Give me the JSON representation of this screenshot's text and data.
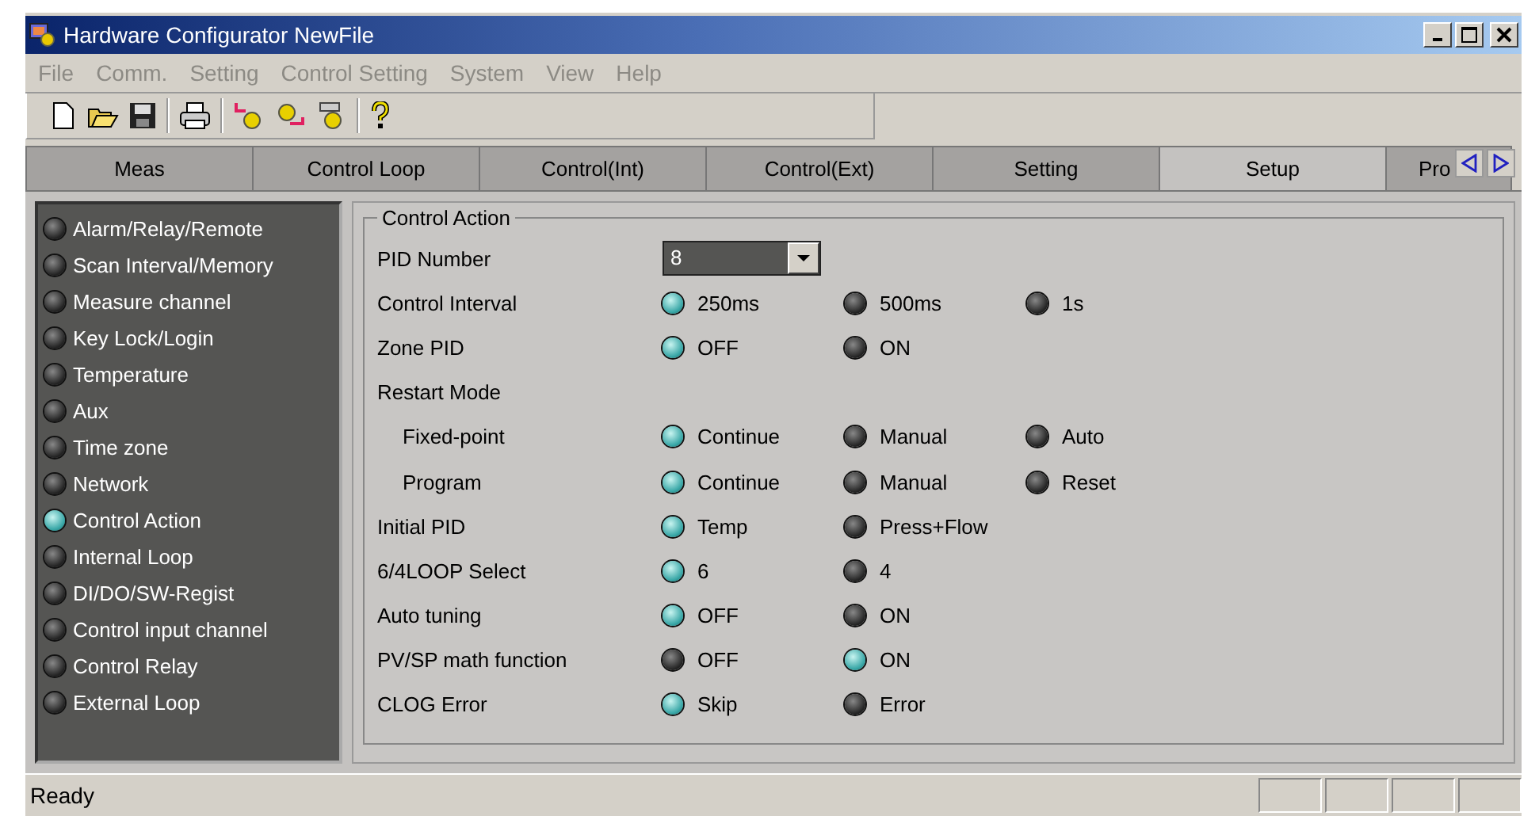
{
  "window": {
    "title": "Hardware Configurator NewFile"
  },
  "menu": [
    {
      "label": "File",
      "disabled": true
    },
    {
      "label": "Comm.",
      "disabled": true
    },
    {
      "label": "Setting",
      "disabled": true
    },
    {
      "label": "Control Setting",
      "disabled": true
    },
    {
      "label": "System",
      "disabled": true
    },
    {
      "label": "View",
      "disabled": true
    },
    {
      "label": "Help",
      "disabled": true
    }
  ],
  "tabs": [
    {
      "label": "Meas",
      "selected": false
    },
    {
      "label": "Control Loop",
      "selected": false
    },
    {
      "label": "Control(Int)",
      "selected": false
    },
    {
      "label": "Control(Ext)",
      "selected": false
    },
    {
      "label": "Setting",
      "selected": false
    },
    {
      "label": "Setup",
      "selected": true
    },
    {
      "label": "Pro",
      "selected": false
    }
  ],
  "sidebar": {
    "items": [
      {
        "label": "Alarm/Relay/Remote",
        "selected": false
      },
      {
        "label": "Scan Interval/Memory",
        "selected": false
      },
      {
        "label": "Measure channel",
        "selected": false
      },
      {
        "label": "Key Lock/Login",
        "selected": false
      },
      {
        "label": "Temperature",
        "selected": false
      },
      {
        "label": "Aux",
        "selected": false
      },
      {
        "label": "Time zone",
        "selected": false
      },
      {
        "label": "Network",
        "selected": false
      },
      {
        "label": "Control Action",
        "selected": true
      },
      {
        "label": "Internal Loop",
        "selected": false
      },
      {
        "label": "DI/DO/SW-Regist",
        "selected": false
      },
      {
        "label": "Control input channel",
        "selected": false
      },
      {
        "label": "Control Relay",
        "selected": false
      },
      {
        "label": "External Loop",
        "selected": false
      }
    ]
  },
  "group": {
    "title": "Control Action",
    "rows": [
      {
        "kind": "dropdown",
        "label": "PID Number",
        "value": "8"
      },
      {
        "kind": "radio",
        "label": "Control Interval",
        "options": [
          {
            "label": "250ms",
            "selected": true
          },
          {
            "label": "500ms",
            "selected": false
          },
          {
            "label": "1s",
            "selected": false
          }
        ]
      },
      {
        "kind": "radio",
        "label": "Zone PID",
        "options": [
          {
            "label": "OFF",
            "selected": true
          },
          {
            "label": "ON",
            "selected": false
          }
        ]
      },
      {
        "kind": "group",
        "label": "Restart Mode",
        "children": [
          {
            "kind": "radio",
            "label": "Fixed-point",
            "options": [
              {
                "label": "Continue",
                "selected": true
              },
              {
                "label": "Manual",
                "selected": false
              },
              {
                "label": "Auto",
                "selected": false
              }
            ]
          },
          {
            "kind": "radio",
            "label": "Program",
            "options": [
              {
                "label": "Continue",
                "selected": true
              },
              {
                "label": "Manual",
                "selected": false
              },
              {
                "label": "Reset",
                "selected": false
              }
            ]
          }
        ]
      },
      {
        "kind": "radio",
        "label": "Initial PID",
        "options": [
          {
            "label": "Temp",
            "selected": true
          },
          {
            "label": "Press+Flow",
            "selected": false
          }
        ]
      },
      {
        "kind": "radio",
        "label": "6/4LOOP Select",
        "options": [
          {
            "label": "6",
            "selected": true
          },
          {
            "label": "4",
            "selected": false
          }
        ]
      },
      {
        "kind": "radio",
        "label": "Auto tuning",
        "options": [
          {
            "label": "OFF",
            "selected": true
          },
          {
            "label": "ON",
            "selected": false
          }
        ]
      },
      {
        "kind": "radio",
        "label": "PV/SP math function",
        "options": [
          {
            "label": "OFF",
            "selected": false
          },
          {
            "label": "ON",
            "selected": true
          }
        ]
      },
      {
        "kind": "radio",
        "label": "CLOG Error",
        "options": [
          {
            "label": "Skip",
            "selected": true
          },
          {
            "label": "Error",
            "selected": false
          }
        ]
      }
    ]
  },
  "status_bar": {
    "text": "Ready"
  }
}
